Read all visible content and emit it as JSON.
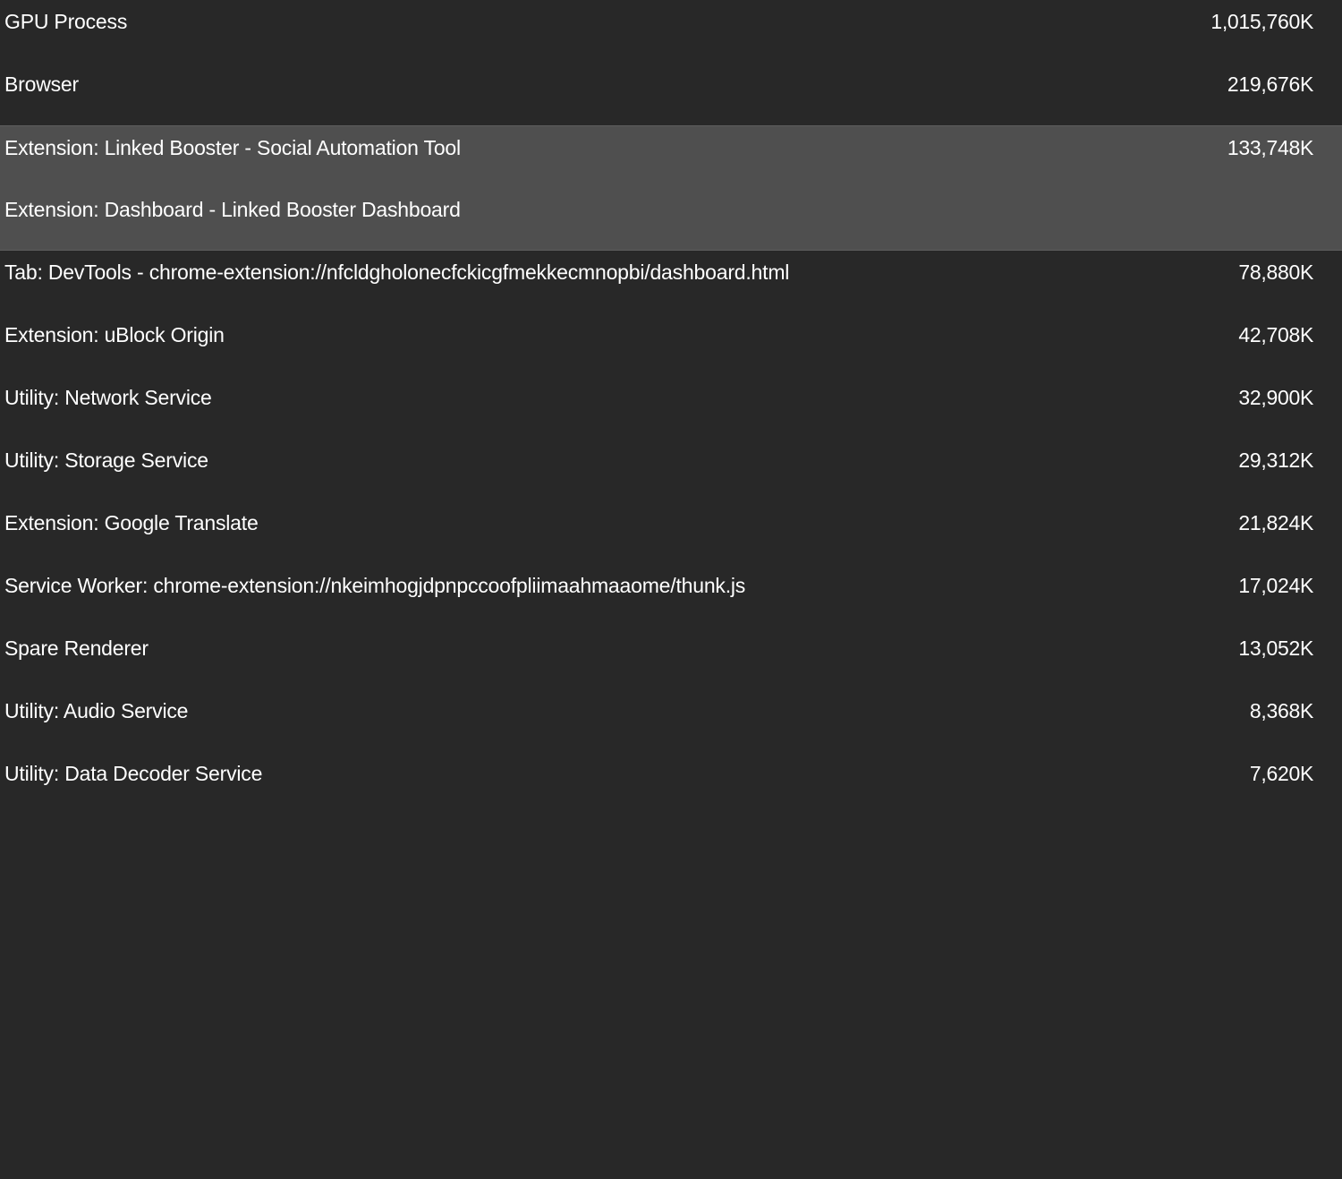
{
  "processes": [
    {
      "name": "GPU Process",
      "memory": "1,015,760K"
    },
    {
      "name": "Browser",
      "memory": "219,676K"
    },
    {
      "name": "Extension: Linked Booster - Social Automation Tool",
      "memory": "133,748K"
    },
    {
      "name": "Extension: Dashboard - Linked Booster Dashboard",
      "memory": ""
    },
    {
      "name": "Tab: DevTools - chrome-extension://nfcldgholonecfckicgfmekkecmnopbi/dashboard.html",
      "memory": "78,880K"
    },
    {
      "name": "Extension: uBlock Origin",
      "memory": "42,708K"
    },
    {
      "name": "Utility: Network Service",
      "memory": "32,900K"
    },
    {
      "name": "Utility: Storage Service",
      "memory": "29,312K"
    },
    {
      "name": "Extension: Google Translate",
      "memory": "21,824K"
    },
    {
      "name": "Service Worker: chrome-extension://nkeimhogjdpnpccoofpliimaahmaaome/thunk.js",
      "memory": "17,024K"
    },
    {
      "name": "Spare Renderer",
      "memory": "13,052K"
    },
    {
      "name": "Utility: Audio Service",
      "memory": "8,368K"
    },
    {
      "name": "Utility: Data Decoder Service",
      "memory": "7,620K"
    }
  ],
  "colors": {
    "background": "#282828",
    "selected_row": "#4f4f4f",
    "text": "#ffffff"
  }
}
